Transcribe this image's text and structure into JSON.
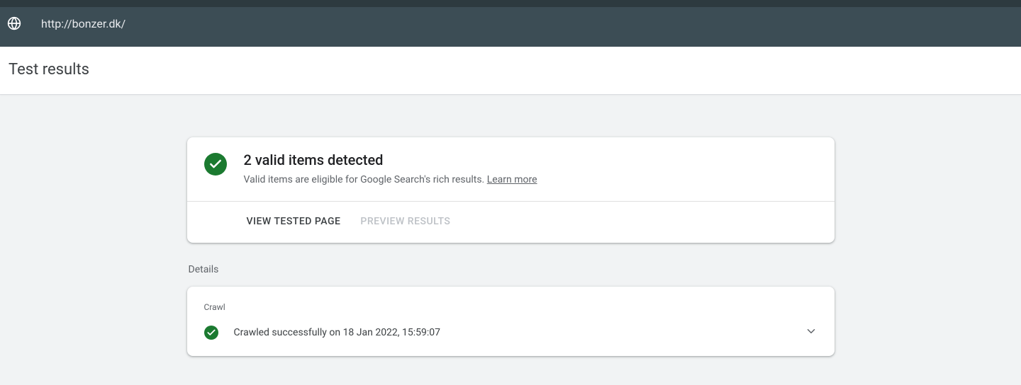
{
  "url_bar": {
    "url": "http://bonzer.dk/"
  },
  "header": {
    "title": "Test results"
  },
  "summary_card": {
    "title": "2 valid items detected",
    "subtitle": "Valid items are eligible for Google Search's rich results. ",
    "learn_more": "Learn more",
    "actions": {
      "view_tested_page": "VIEW TESTED PAGE",
      "preview_results": "PREVIEW RESULTS"
    }
  },
  "details": {
    "section_label": "Details",
    "crawl": {
      "label": "Crawl",
      "status_text": "Crawled successfully on 18 Jan 2022, 15:59:07"
    }
  }
}
